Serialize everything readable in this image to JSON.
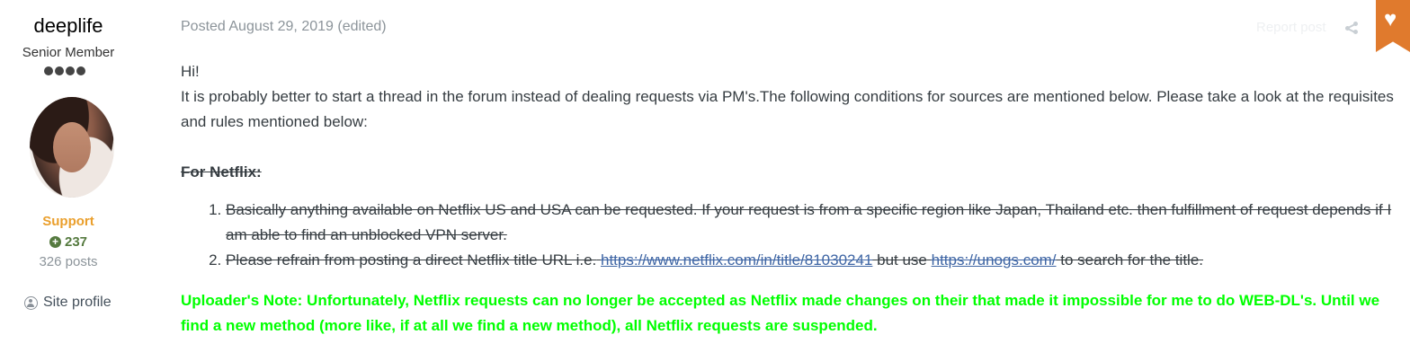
{
  "author": {
    "name": "deeplife",
    "rank": "Senior Member",
    "group": "Support",
    "reputation": "237",
    "posts": "326 posts",
    "site_profile_label": "Site profile"
  },
  "post": {
    "posted": "Posted August 29, 2019",
    "edited": "(edited)",
    "report_label": "Report post",
    "greeting": "Hi!",
    "intro": "It is probably better to start a thread in the forum instead of dealing requests via PM's.The following conditions for sources are mentioned below. Please take a look at the requisites and rules mentioned below:",
    "netflix_heading": "For Netflix:",
    "rule1": "Basically anything available on Netflix US and USA can be requested. If your request is from a specific region like Japan, Thailand etc. then fulfillment of request depends if I am able to find an unblocked VPN server.",
    "rule2_part1": "Please refrain from posting a direct Netflix title URL i.e.",
    "rule2_link1": "https://www.netflix.com/in/title/81030241",
    "rule2_part2": "but use",
    "rule2_link2": "https://unogs.com/",
    "rule2_part3": "to search for the title.",
    "uploader_note": "Uploader's Note: Unfortunately, Netflix requests can no longer be accepted as Netflix made changes on their that made it impossible for me to do WEB-DL's. Until we find a new method (more like, if at all we find a new method), all Netflix requests are suspended."
  },
  "colors": {
    "group": "#ea9f2c",
    "reputation": "#557a3f",
    "note": "#00ff00",
    "link": "#3e65a4",
    "badge": "#e07a2d"
  },
  "icons": {
    "reputation": "plus-circle-icon",
    "profile": "user-circle-icon",
    "share": "share-icon",
    "badge": "heart-icon"
  }
}
